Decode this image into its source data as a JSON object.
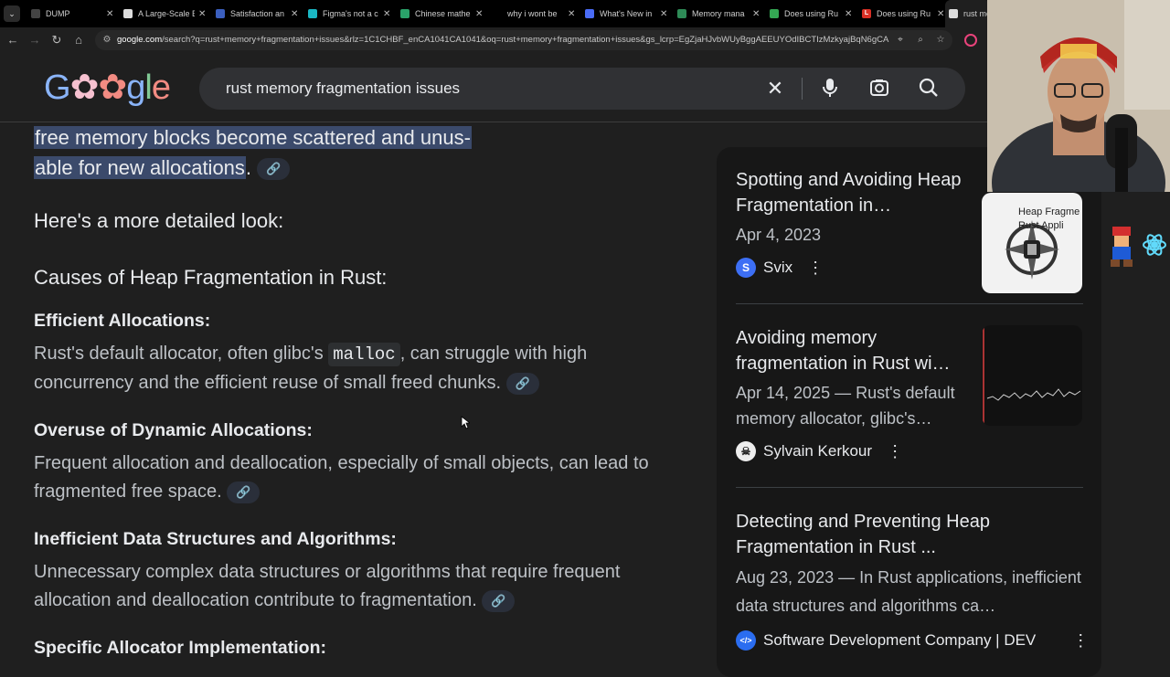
{
  "tabs": [
    {
      "title": "DUMP",
      "fav": "#444",
      "fav_label": ""
    },
    {
      "title": "A Large-Scale E",
      "fav": "#ddd",
      "fav_label": ""
    },
    {
      "title": "Satisfaction an",
      "fav": "#3b5fbf",
      "fav_label": ""
    },
    {
      "title": "Figma's not a c",
      "fav": "#1ab7c4",
      "fav_label": ""
    },
    {
      "title": "Chinese mathe",
      "fav": "#2aa36a",
      "fav_label": ""
    },
    {
      "title": "why i wont be",
      "fav": "#000",
      "fav_label": ""
    },
    {
      "title": "What's New in",
      "fav": "#4a6cf7",
      "fav_label": ""
    },
    {
      "title": "Memory mana",
      "fav": "#2e8b57",
      "fav_label": ""
    },
    {
      "title": "Does using Ru",
      "fav": "#34a853",
      "fav_label": ""
    },
    {
      "title": "Does using Ru",
      "fav": "#d93025",
      "fav_label": "L"
    },
    {
      "title": "rust me",
      "fav": "#ddd",
      "fav_label": ""
    }
  ],
  "address": {
    "domain": "google.com",
    "path": "/search?q=rust+memory+fragmentation+issues&rlz=1C1CHBF_enCA1041CA1041&oq=rust+memory+fragmentation+issues&gs_lcrp=EgZjaHJvbWUyBggAEEUYOdIBCTIzMzkyajBqN6gCALAC..."
  },
  "search": {
    "query": "rust memory fragmentation issues"
  },
  "content": {
    "highlight_line1": "free memory blocks become scattered and unus-",
    "highlight_line2": "able for new allocations",
    "highlight_tail": ".",
    "detailed": "Here's a more detailed look:",
    "causes_heading": "Causes of Heap Fragmentation in Rust:",
    "sections": [
      {
        "title": "Efficient Allocations:",
        "text_a": "Rust's default allocator, often glibc's ",
        "code": "malloc",
        "text_b": ", can struggle with high concurrency and the efficient reuse of small freed chunks."
      },
      {
        "title": "Overuse of Dynamic Allocations:",
        "text_a": "Frequent allocation and deallocation, especially of small objects, can lead to fragmented free space."
      },
      {
        "title": "Inefficient Data Structures and Algorithms:",
        "text_a": "Unnecessary complex data structures or algorithms that require frequent allocation and deallocation contribute to fragmentation."
      },
      {
        "title": "Specific Allocator Implementation:"
      }
    ]
  },
  "sources": [
    {
      "title": "Spotting and Avoiding Heap Fragmentation in…",
      "date": "Apr 4, 2023",
      "site": "Svix",
      "icon_letter": "S",
      "icon_color": "#3d6ff5",
      "thumb_text": "Heap Fragme Rust Appli"
    },
    {
      "title": "Avoiding memory fragmentation in Rust wi…",
      "date": "Apr 14, 2025 — Rust's default memory allocator, glibc's…",
      "site": "Sylvain Kerkour",
      "icon_letter": "☠",
      "icon_color": "#eeeeee"
    },
    {
      "title": "Detecting and Preventing Heap Fragmentation in Rust ...",
      "date": "Aug 23, 2023 — In Rust applications, inefficient data structures and algorithms ca…",
      "site": "Software Development Company | DEV",
      "icon_letter": "</>",
      "icon_color": "#2b6df0"
    }
  ],
  "colors": {
    "highlight": "#3b4a6b",
    "link": "#a8c7fa",
    "background": "#1f1f1f"
  }
}
